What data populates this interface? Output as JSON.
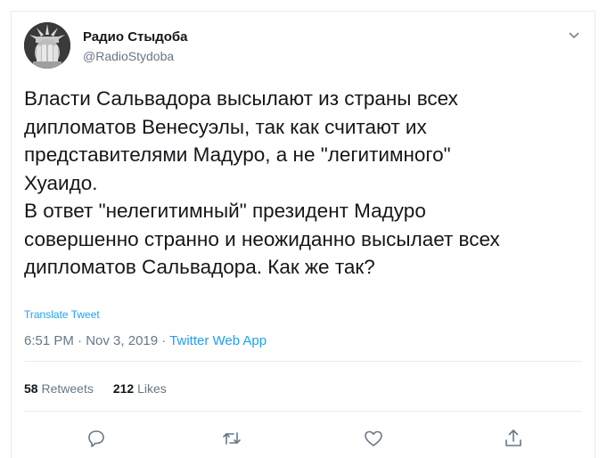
{
  "account": {
    "display_name": "Радио Стыдоба",
    "handle": "@RadioStydoba"
  },
  "tweet": {
    "text": "Власти Сальвадора высылают из страны всех\nдипломатов Венесуэлы, так как считают их\nпредставителями Мадуро, а не \"легитимного\"\nХуаидо.\nВ ответ \"нелегитимный\" президент Мадуро\nсовершенно странно и неожиданно высылает всех\nдипломатов Сальвадора. Как же так?",
    "translate_label": "Translate Tweet",
    "time": "6:51 PM",
    "date": "Nov 3, 2019",
    "separator": " · ",
    "source": "Twitter Web App"
  },
  "stats": {
    "retweets_count": "58",
    "retweets_label": "Retweets",
    "likes_count": "212",
    "likes_label": "Likes"
  },
  "icons": {
    "reply": "reply-icon",
    "retweet": "retweet-icon",
    "like": "like-icon",
    "share": "share-icon",
    "menu": "chevron-down-icon"
  },
  "colors": {
    "accent": "#1da1f2",
    "secondary_text": "#657786",
    "primary_text": "#14171a",
    "border": "#e6ecf0"
  }
}
